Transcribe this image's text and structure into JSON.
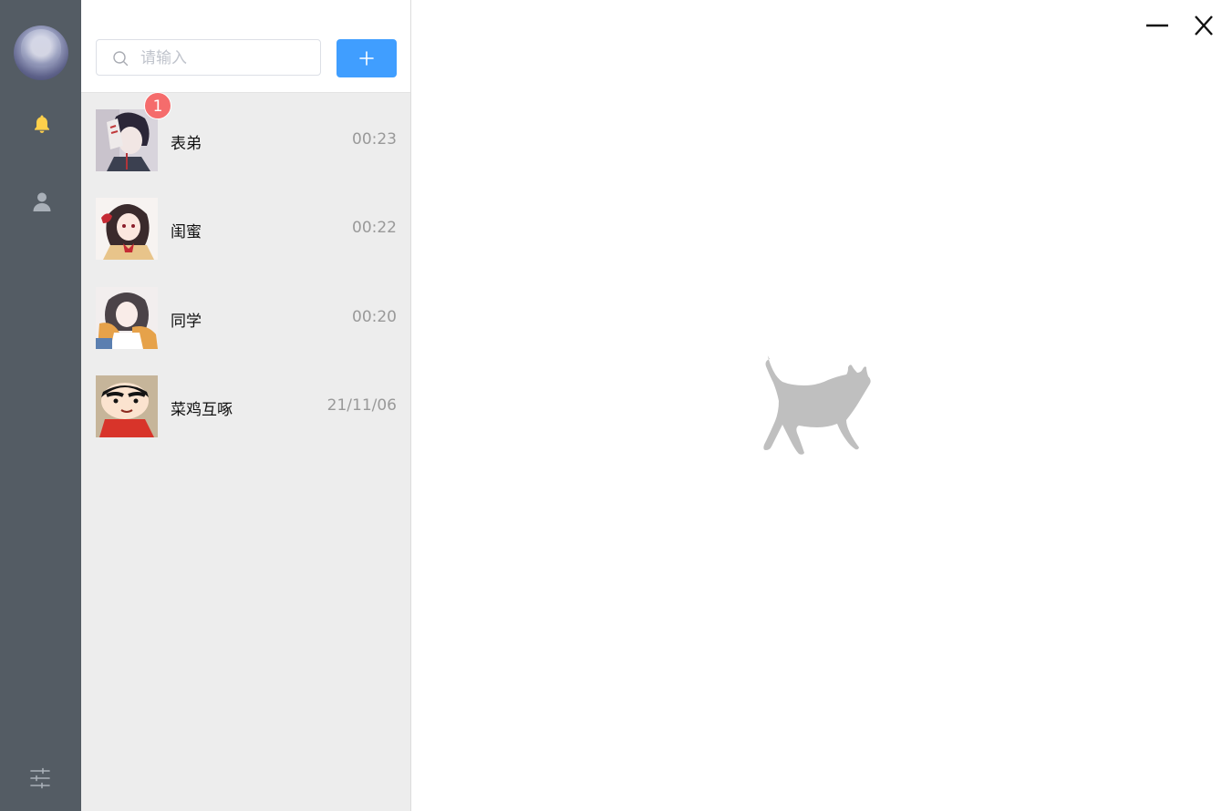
{
  "search": {
    "placeholder": "请输入"
  },
  "add_button": {
    "icon": "plus-icon",
    "color": "#409eff"
  },
  "conversations": [
    {
      "name": "表弟",
      "time": "00:23",
      "unread": "1"
    },
    {
      "name": "闺蜜",
      "time": "00:22"
    },
    {
      "name": "同学",
      "time": "00:20"
    },
    {
      "name": "菜鸡互啄",
      "time": "21/11/06"
    }
  ],
  "colors": {
    "rail": "#545c64",
    "accent": "#409eff",
    "badge": "#f56c6c",
    "notify_icon": "#ffd04b",
    "list_bg": "#ededed"
  },
  "icons": {
    "nav": [
      "bell-icon",
      "user-icon",
      "sliders-icon"
    ],
    "window": [
      "minimize-icon",
      "close-icon"
    ],
    "empty_state": "cat-icon"
  }
}
